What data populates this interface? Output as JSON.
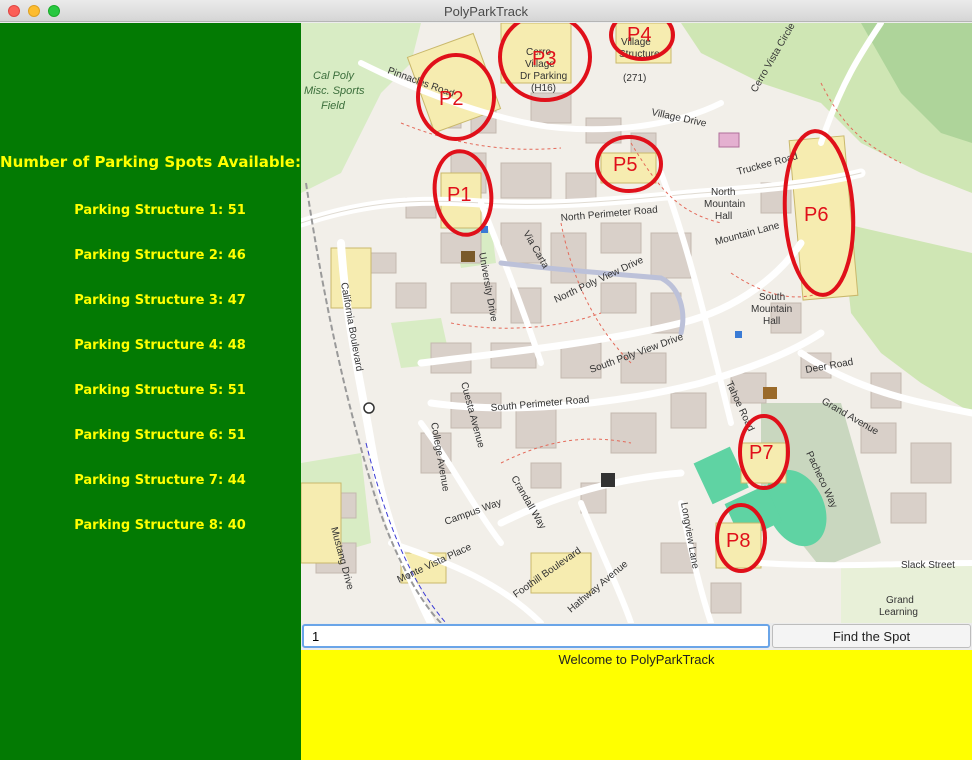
{
  "window": {
    "title": "PolyParkTrack"
  },
  "sidebar": {
    "heading": "Number of Parking Spots Available:",
    "structures": [
      {
        "label": "Parking Structure 1: 51"
      },
      {
        "label": "Parking Structure 2: 46"
      },
      {
        "label": "Parking Structure 3: 47"
      },
      {
        "label": "Parking Structure 4: 48"
      },
      {
        "label": "Parking Structure 5: 51"
      },
      {
        "label": "Parking Structure 6: 51"
      },
      {
        "label": "Parking Structure 7: 44"
      },
      {
        "label": "Parking Structure 8: 40"
      }
    ]
  },
  "map": {
    "markers": [
      "P1",
      "P2",
      "P3",
      "P4",
      "P5",
      "P6",
      "P7",
      "P8"
    ],
    "field_label": [
      "Cal Poly",
      "Misc. Sports",
      "Field"
    ],
    "streets": {
      "pinnacles": "Pinnacles Road",
      "village": "Village Drive",
      "north_perimeter": "North Perimeter Road",
      "truckee": "Truckee Road",
      "mountain": "Mountain Lane",
      "university": "University Drive",
      "via_carta": "Via Carta",
      "north_poly_view": "North Poly View Drive",
      "south_poly_view": "South Poly View Drive",
      "south_perimeter": "South Perimeter Road",
      "california": "California Boulevard",
      "cuesta": "Cuesta Avenue",
      "college": "College Avenue",
      "campus_way": "Campus Way",
      "crandall": "Crandall Way",
      "grand": "Grand Avenue",
      "deer": "Deer Road",
      "slack": "Slack Street",
      "mustang": "Mustang Drive",
      "monte_vista": "Monte Vista Place",
      "foothill": "Foothill Boulevard",
      "hathway": "Hathway Avenue",
      "longview": "Longview Lane",
      "pacheco": "Pacheco Way",
      "tahoe": "Tahoe Road",
      "cerro_vista": "Cerro Vista Circle"
    },
    "places": {
      "north_mountain": [
        "North",
        "Mountain",
        "Hall"
      ],
      "south_mountain": [
        "South",
        "Mountain",
        "Hall"
      ],
      "grand_learning": [
        "Grand",
        "Learning"
      ],
      "village_parking": [
        "Cerro",
        "Village",
        "Dr Parking",
        "(H16)"
      ],
      "village_structure": [
        "Village",
        "Structure",
        "(271)"
      ]
    }
  },
  "search": {
    "value": "1",
    "button_label": "Find the Spot"
  },
  "status": {
    "message": "Welcome to PolyParkTrack"
  },
  "colors": {
    "sidebar_bg": "#037a03",
    "sidebar_text": "#ffff00",
    "status_bg": "#ffff00",
    "marker": "#e0101a"
  }
}
